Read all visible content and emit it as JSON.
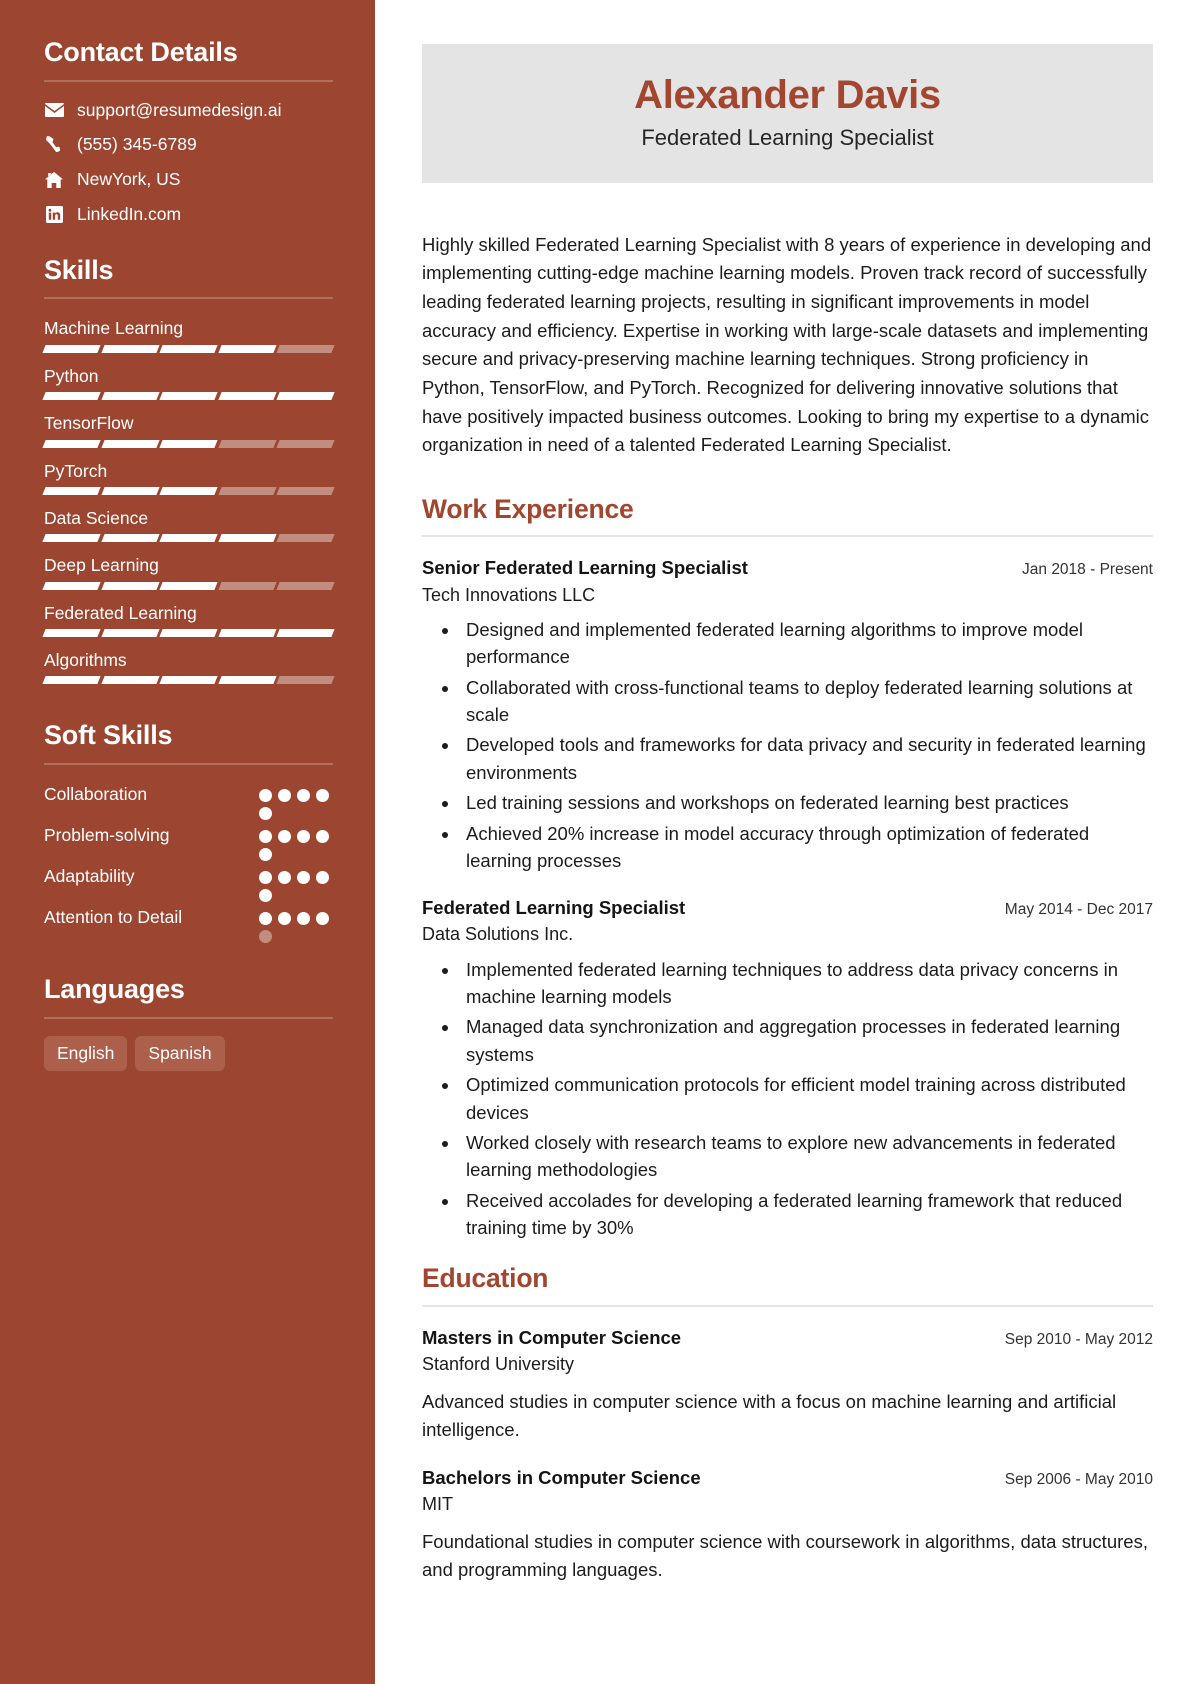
{
  "theme": {
    "sidebar_bg": "#9c4631",
    "accent": "#a2462f",
    "header_bg": "#e4e4e4",
    "bar_empty": "#c08d7e",
    "bar_full": "#ffffff",
    "tag_bg": "#ac5f4b"
  },
  "header": {
    "name": "Alexander Davis",
    "role": "Federated Learning Specialist"
  },
  "summary": "Highly skilled Federated Learning Specialist with 8 years of experience in developing and implementing cutting-edge machine learning models. Proven track record of successfully leading federated learning projects, resulting in significant improvements in model accuracy and efficiency. Expertise in working with large-scale datasets and implementing secure and privacy-preserving machine learning techniques. Strong proficiency in Python, TensorFlow, and PyTorch. Recognized for delivering innovative solutions that have positively impacted business outcomes. Looking to bring my expertise to a dynamic organization in need of a talented Federated Learning Specialist.",
  "sidebar": {
    "contact": {
      "title": "Contact Details",
      "items": [
        {
          "icon": "envelope-icon",
          "text": "support@resumedesign.ai"
        },
        {
          "icon": "phone-icon",
          "text": "(555) 345-6789"
        },
        {
          "icon": "home-icon",
          "text": "NewYork, US"
        },
        {
          "icon": "linkedin-icon",
          "text": "LinkedIn.com"
        }
      ]
    },
    "skills": {
      "title": "Skills",
      "max": 5,
      "items": [
        {
          "name": "Machine Learning",
          "level": 4
        },
        {
          "name": "Python",
          "level": 5
        },
        {
          "name": "TensorFlow",
          "level": 3
        },
        {
          "name": "PyTorch",
          "level": 3
        },
        {
          "name": "Data Science",
          "level": 4
        },
        {
          "name": "Deep Learning",
          "level": 3
        },
        {
          "name": "Federated Learning",
          "level": 5
        },
        {
          "name": "Algorithms",
          "level": 4
        }
      ]
    },
    "soft_skills": {
      "title": "Soft Skills",
      "max": 5,
      "items": [
        {
          "name": "Collaboration",
          "level": 5
        },
        {
          "name": "Problem-solving",
          "level": 5
        },
        {
          "name": "Adaptability",
          "level": 5
        },
        {
          "name": "Attention to Detail",
          "level": 4
        }
      ]
    },
    "languages": {
      "title": "Languages",
      "items": [
        "English",
        "Spanish"
      ]
    }
  },
  "sections": {
    "work": {
      "title": "Work Experience",
      "entries": [
        {
          "title": "Senior Federated Learning Specialist",
          "org": "Tech Innovations LLC",
          "date": "Jan 2018 - Present",
          "bullets": [
            "Designed and implemented federated learning algorithms to improve model performance",
            "Collaborated with cross-functional teams to deploy federated learning solutions at scale",
            "Developed tools and frameworks for data privacy and security in federated learning environments",
            "Led training sessions and workshops on federated learning best practices",
            "Achieved 20% increase in model accuracy through optimization of federated learning processes"
          ]
        },
        {
          "title": "Federated Learning Specialist",
          "org": "Data Solutions Inc.",
          "date": "May 2014 - Dec 2017",
          "bullets": [
            "Implemented federated learning techniques to address data privacy concerns in machine learning models",
            "Managed data synchronization and aggregation processes in federated learning systems",
            "Optimized communication protocols for efficient model training across distributed devices",
            "Worked closely with research teams to explore new advancements in federated learning methodologies",
            "Received accolades for developing a federated learning framework that reduced training time by 30%"
          ]
        }
      ]
    },
    "education": {
      "title": "Education",
      "entries": [
        {
          "title": "Masters in Computer Science",
          "org": "Stanford University",
          "date": "Sep 2010 - May 2012",
          "desc": "Advanced studies in computer science with a focus on machine learning and artificial intelligence."
        },
        {
          "title": "Bachelors in Computer Science",
          "org": "MIT",
          "date": "Sep 2006 - May 2010",
          "desc": "Foundational studies in computer science with coursework in algorithms, data structures, and programming languages."
        }
      ]
    }
  }
}
